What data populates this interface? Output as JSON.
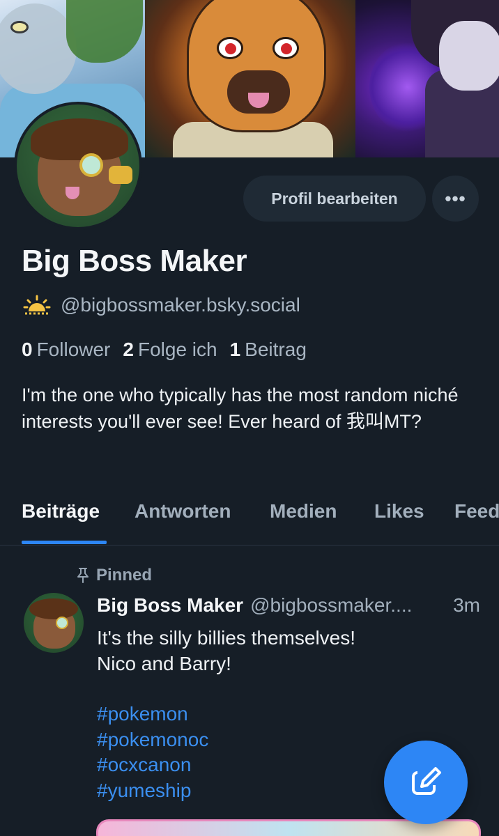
{
  "profile": {
    "display_name": "Big Boss Maker",
    "handle": "@bigbossmaker.bsky.social",
    "status_icon": "sun-icon",
    "edit_label": "Profil bearbeiten",
    "more_label": "•••",
    "stats": {
      "followers_count": "0",
      "followers_label": "Follower",
      "following_count": "2",
      "following_label": "Folge ich",
      "posts_count": "1",
      "posts_label": "Beitrag"
    },
    "bio": "I'm the one who typically has the most random niché interests you'll ever see! Ever heard of 我叫MT?"
  },
  "tabs": [
    {
      "label": "Beiträge",
      "active": true
    },
    {
      "label": "Antworten",
      "active": false
    },
    {
      "label": "Medien",
      "active": false
    },
    {
      "label": "Likes",
      "active": false
    },
    {
      "label": "Feeds",
      "active": false
    }
  ],
  "post": {
    "pinned_label": "Pinned",
    "author": "Big Boss Maker",
    "handle": "@bigbossmaker....",
    "time": "3m",
    "line1": "It's the silly billies themselves!",
    "line2": "Nico and Barry!",
    "hashtags": [
      "#pokemon",
      "#pokemonoc",
      "#ocxcanon",
      "#yumeship"
    ]
  },
  "colors": {
    "background": "#161e27",
    "accent": "#2d86f5",
    "hashtag": "#3b8ff0",
    "muted_text": "#a2afbc"
  },
  "icons": {
    "more": "more-dots-icon",
    "pin": "pin-icon",
    "compose": "compose-icon"
  }
}
